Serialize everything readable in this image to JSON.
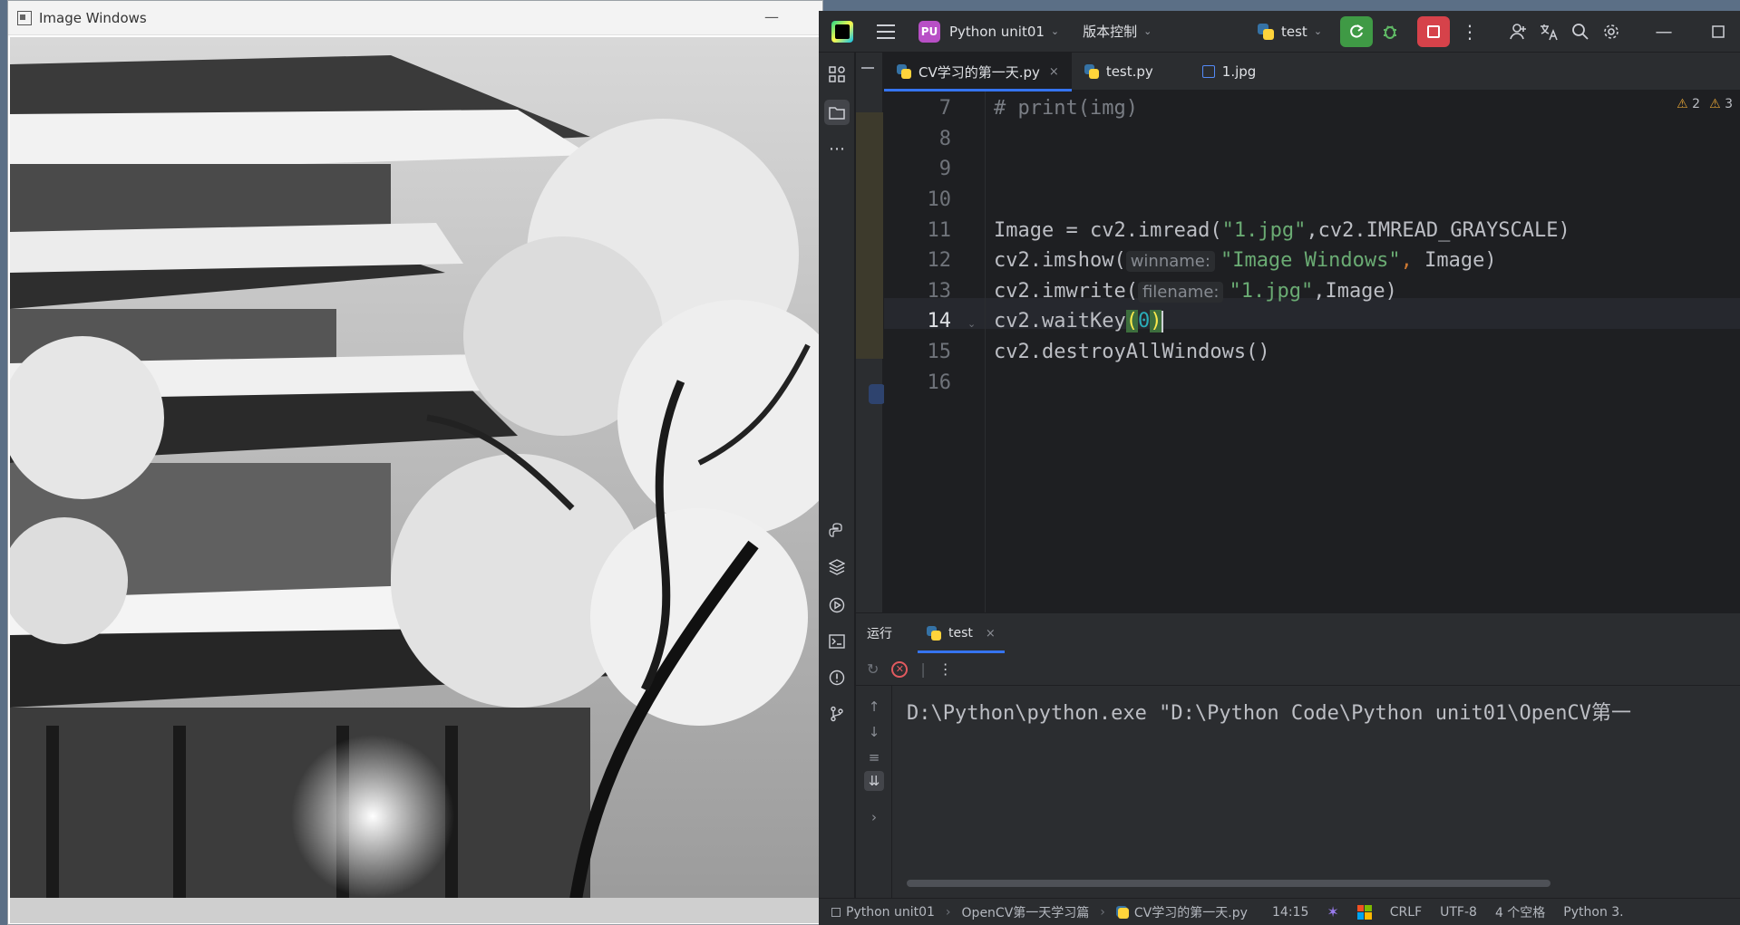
{
  "image_window": {
    "title": "Image Windows",
    "minimize_label": "—"
  },
  "ide": {
    "project_badge": "PU",
    "project_name": "Python unit01",
    "vcs_label": "版本控制",
    "run_config": "test",
    "tabs": [
      {
        "label": "CV学习的第一天.py",
        "close": "×"
      },
      {
        "label": "test.py"
      },
      {
        "label": "1.jpg"
      }
    ],
    "warnings": {
      "a": "2",
      "b": "3"
    },
    "line_numbers": [
      "7",
      "8",
      "9",
      "10",
      "11",
      "12",
      "13",
      "14",
      "15",
      "16"
    ],
    "code": {
      "l7": "# print(img)",
      "l11_a": "Image = cv2.imread(",
      "l11_str": "\"1.jpg\"",
      "l11_b": ",cv2.IMREAD_GRAYSCALE)",
      "l12_a": "cv2.imshow(",
      "l12_hint": "winname:",
      "l12_str": "\"Image Windows\"",
      "l12_comma": ",",
      "l12_b": " Image)",
      "l13_a": "cv2.imwrite(",
      "l13_hint": "filename:",
      "l13_str": "\"1.jpg\"",
      "l13_b": ",Image)",
      "l14_a": "cv2.waitKey",
      "l14_open": "(",
      "l14_num": "0",
      "l14_close": ")",
      "l15": "cv2.destroyAllWindows()"
    },
    "run_panel": {
      "label": "运行",
      "tab": "test",
      "console_line": "D:\\Python\\python.exe \"D:\\Python Code\\Python unit01\\OpenCV第一"
    },
    "status": {
      "crumb_project": "Python unit01",
      "crumb_folder": "OpenCV第一天学习篇",
      "crumb_file": "CV学习的第一天.py",
      "position": "14:15",
      "line_sep": "CRLF",
      "encoding": "UTF-8",
      "indent": "4 个空格",
      "interpreter": "Python 3."
    },
    "colors": {
      "accent": "#3574f0",
      "run_green": "#3f9a45",
      "stop_red": "#d6424a",
      "string": "#6aab73",
      "number": "#2aacb8"
    }
  }
}
